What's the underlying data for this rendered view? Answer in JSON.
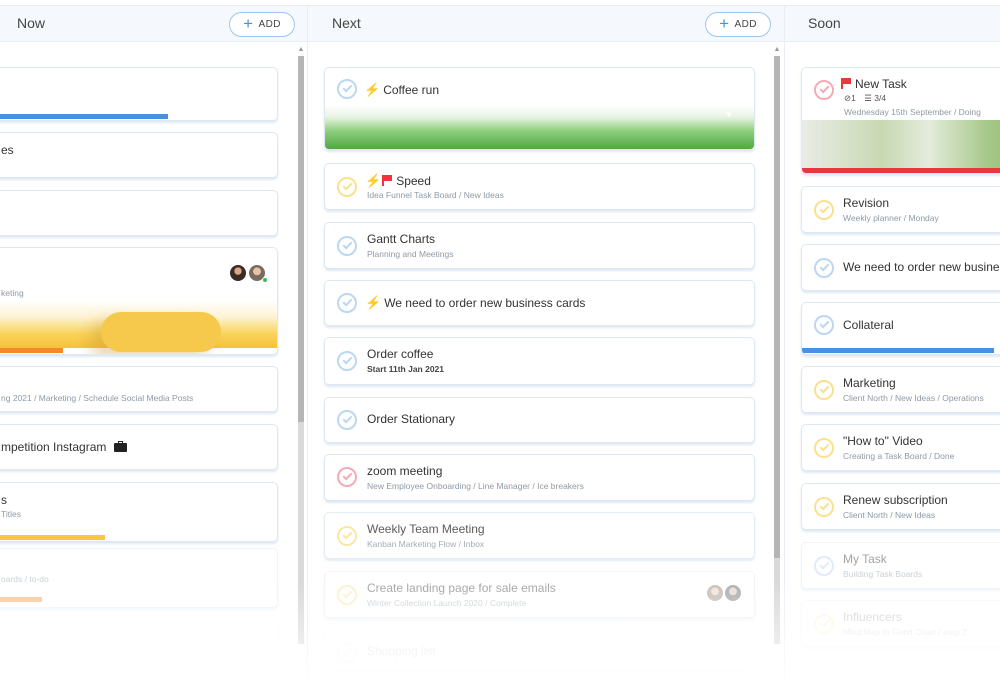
{
  "columns": {
    "now": {
      "title": "Now",
      "add_label": "ADD",
      "cards": [
        {
          "title": "",
          "sub": ""
        },
        {
          "title": "es",
          "sub": ""
        },
        {
          "title": "",
          "sub": ""
        },
        {
          "title": "",
          "sub": "keting"
        },
        {
          "title": "",
          "sub": "ng 2021 / Marketing / Schedule Social Media Posts"
        },
        {
          "title": "mpetition Instagram",
          "sub": ""
        },
        {
          "title": "s",
          "sub": "Titles"
        },
        {
          "title": "",
          "sub": "oards / to-do"
        }
      ]
    },
    "next": {
      "title": "Next",
      "add_label": "ADD",
      "cards": [
        {
          "title": "Coffee run",
          "sub": ""
        },
        {
          "title": "Speed",
          "sub": "Idea Funnel Task Board / New Ideas"
        },
        {
          "title": "Gantt Charts",
          "sub": "Planning and Meetings"
        },
        {
          "title": "We need to order new business cards",
          "sub": ""
        },
        {
          "title": "Order coffee",
          "sub": "Start 11th Jan 2021"
        },
        {
          "title": "Order Stationary",
          "sub": ""
        },
        {
          "title": "zoom meeting",
          "sub": "New Employee Onboarding / Line Manager / Ice breakers"
        },
        {
          "title": "Weekly Team Meeting",
          "sub": "Kanban Marketing Flow / Inbox"
        },
        {
          "title": "Create landing page for sale emails",
          "sub": "Winter Collection Launch 2020 / Complete"
        },
        {
          "title": "Shopping list",
          "sub": ""
        }
      ]
    },
    "soon": {
      "title": "Soon",
      "cards": [
        {
          "title": "New Task",
          "attachments": "1",
          "checklist": "3/4",
          "sub": "Wednesday 15th September / Doing"
        },
        {
          "title": "Revision",
          "sub": "Weekly planner / Monday"
        },
        {
          "title": "We need to order new busines",
          "sub": ""
        },
        {
          "title": "Collateral",
          "sub": ""
        },
        {
          "title": "Marketing",
          "sub": "Client North / New Ideas / Operations"
        },
        {
          "title": "\"How to\" Video",
          "sub": "Creating a Task Board / Done"
        },
        {
          "title": "Renew subscription",
          "sub": "Client North / New Ideas"
        },
        {
          "title": "My Task",
          "sub": "Building Task Boards"
        },
        {
          "title": "Influencers",
          "sub": "Mind Map to Gantt Chart / map 2"
        }
      ]
    }
  },
  "progress": {
    "now_card1": 0.61,
    "now_card4": 0.23,
    "now_card7": 0.38,
    "now_card8": 0.15,
    "soon_collateral": 0.97
  },
  "colors": {
    "accent_blue": "#4a90e2",
    "progress_orange": "#f5892a",
    "progress_yellow": "#f7c644",
    "red": "#e8383d",
    "check_blue": "#bcd7f3",
    "check_yellow": "#fbe08e",
    "check_red": "#f5aab6"
  },
  "icons": [
    "plus-icon",
    "check-circle-icon",
    "bolt-icon",
    "flag-icon",
    "paperclip-icon",
    "checklist-icon",
    "briefcase-icon",
    "chevron-down-icon",
    "scroll-up-arrow-icon",
    "avatar"
  ]
}
